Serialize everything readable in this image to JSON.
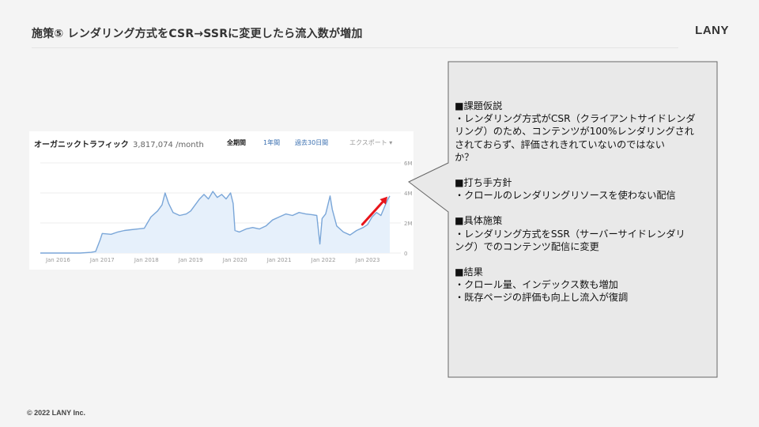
{
  "slide": {
    "title": "施策⑤ レンダリング方式をCSR→SSRに変更したら流入数が増加",
    "logo": "LANY",
    "footer": "© 2022 LANY Inc."
  },
  "chart_card": {
    "title": "オーガニックトラフィック",
    "value": "3,817,074 /month",
    "tabs": [
      "全期間",
      "1年間",
      "過去30日間",
      "エクスポート ▾"
    ],
    "annotation_arrow_color": "#e8141b"
  },
  "chart_data": {
    "type": "area",
    "title": "オーガニックトラフィック",
    "x_ticks": [
      "Jan 2016",
      "Jan 2017",
      "Jan 2018",
      "Jan 2019",
      "Jan 2020",
      "Jan 2021",
      "Jan 2022",
      "Jan 2023"
    ],
    "y_ticks": [
      "6M",
      "4M",
      "2M",
      "0"
    ],
    "ylim": [
      0,
      6000000
    ],
    "y_axis_side": "right",
    "grid": true,
    "series": [
      {
        "color": "#7aa6d8",
        "fill": "#e6f0fb",
        "points": [
          [
            2015.6,
            0.0
          ],
          [
            2016.0,
            0.0
          ],
          [
            2016.5,
            0.0
          ],
          [
            2016.75,
            0.05
          ],
          [
            2016.85,
            0.1
          ],
          [
            2016.95,
            0.85
          ],
          [
            2017.0,
            1.3
          ],
          [
            2017.2,
            1.25
          ],
          [
            2017.35,
            1.4
          ],
          [
            2017.5,
            1.5
          ],
          [
            2017.65,
            1.55
          ],
          [
            2017.8,
            1.6
          ],
          [
            2017.95,
            1.65
          ],
          [
            2018.0,
            1.9
          ],
          [
            2018.1,
            2.4
          ],
          [
            2018.25,
            2.8
          ],
          [
            2018.35,
            3.2
          ],
          [
            2018.42,
            4.0
          ],
          [
            2018.5,
            3.3
          ],
          [
            2018.6,
            2.7
          ],
          [
            2018.75,
            2.5
          ],
          [
            2018.9,
            2.6
          ],
          [
            2019.0,
            2.8
          ],
          [
            2019.1,
            3.2
          ],
          [
            2019.2,
            3.6
          ],
          [
            2019.3,
            3.9
          ],
          [
            2019.4,
            3.6
          ],
          [
            2019.5,
            4.1
          ],
          [
            2019.6,
            3.7
          ],
          [
            2019.7,
            3.9
          ],
          [
            2019.8,
            3.6
          ],
          [
            2019.9,
            4.0
          ],
          [
            2019.96,
            3.3
          ],
          [
            2020.0,
            1.5
          ],
          [
            2020.1,
            1.4
          ],
          [
            2020.25,
            1.6
          ],
          [
            2020.4,
            1.7
          ],
          [
            2020.55,
            1.6
          ],
          [
            2020.7,
            1.8
          ],
          [
            2020.85,
            2.2
          ],
          [
            2021.0,
            2.4
          ],
          [
            2021.15,
            2.6
          ],
          [
            2021.3,
            2.5
          ],
          [
            2021.45,
            2.7
          ],
          [
            2021.6,
            2.6
          ],
          [
            2021.75,
            2.55
          ],
          [
            2021.85,
            2.5
          ],
          [
            2021.92,
            0.6
          ],
          [
            2021.97,
            2.3
          ],
          [
            2022.05,
            2.6
          ],
          [
            2022.15,
            3.8
          ],
          [
            2022.2,
            2.9
          ],
          [
            2022.3,
            1.8
          ],
          [
            2022.45,
            1.4
          ],
          [
            2022.6,
            1.2
          ],
          [
            2022.75,
            1.5
          ],
          [
            2022.9,
            1.7
          ],
          [
            2023.0,
            1.9
          ],
          [
            2023.1,
            2.4
          ],
          [
            2023.2,
            2.7
          ],
          [
            2023.3,
            2.5
          ],
          [
            2023.4,
            3.2
          ],
          [
            2023.46,
            3.6
          ],
          [
            2023.5,
            3.8
          ]
        ]
      }
    ]
  },
  "callout": {
    "blocks": [
      {
        "lines": [
          "■課題仮説",
          "・レンダリング方式がCSR（クライアントサイドレンダ",
          "リング）のため、コンテンツが100%レンダリングされ",
          "されておらず、評価されきれていないのではない",
          "か？"
        ]
      },
      {
        "lines": [
          "■打ち手方針",
          "・クロールのレンダリングリソースを使わない配信"
        ]
      },
      {
        "lines": [
          "■具体施策",
          "・レンダリング方式をSSR（サーバーサイドレンダリ",
          "ング）でのコンテンツ配信に変更"
        ]
      },
      {
        "lines": [
          "■結果",
          "・クロール量、インデックス数も増加",
          "・既存ページの評価も向上し流入が復調"
        ]
      }
    ]
  }
}
